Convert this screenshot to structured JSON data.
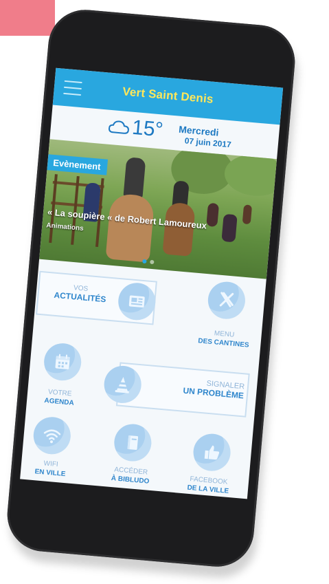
{
  "app": {
    "title": "Vert Saint Denis"
  },
  "weather": {
    "temperature": "15°",
    "day": "Mercredi",
    "date": "07 juin 2017",
    "icon": "cloud-icon"
  },
  "banner": {
    "badge": "Evènement",
    "caption": "« La soupière « de Robert Lamoureux",
    "subcaption": "Animations",
    "slide_count": 2,
    "active_slide": 1
  },
  "tiles": {
    "actualites": {
      "line1": "VOS",
      "line2": "ACTUALITÉS",
      "icon": "news-icon"
    },
    "cantines": {
      "line1": "MENU",
      "line2": "DES CANTINES",
      "icon": "cutlery-icon"
    },
    "agenda": {
      "line1": "VOTRE",
      "line2": "AGENDA",
      "icon": "calendar-icon"
    },
    "signaler": {
      "line1": "SIGNALER",
      "line2": "UN PROBLÈME",
      "icon": "traffic-cone-icon"
    },
    "wifi": {
      "line1": "WIFI",
      "line2": "EN VILLE",
      "icon": "wifi-icon"
    },
    "bibliudo": {
      "line1": "ACCÉDER",
      "line2": "À BIBLUDO",
      "icon": "book-icon"
    },
    "facebook": {
      "line1": "FACEBOOK",
      "line2": "DE LA VILLE",
      "icon": "thumbs-up-icon"
    }
  },
  "colors": {
    "accent": "#29a7df",
    "title_yellow": "#ffe75a",
    "text_blue": "#1d79c2",
    "tile_circle": "#aad0f0",
    "pink_block": "#f07d8a"
  }
}
